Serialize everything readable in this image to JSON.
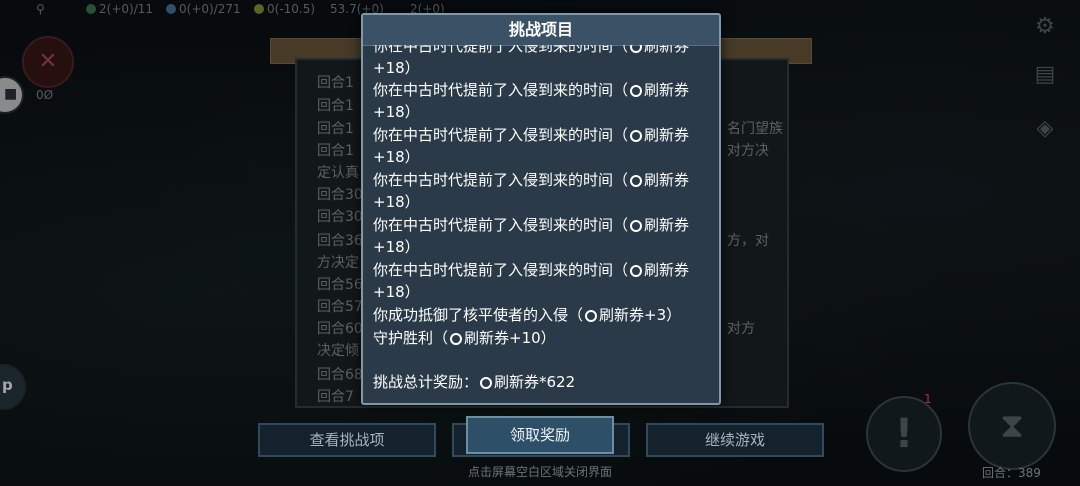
{
  "topbar": {
    "stat1": "2(+0)/11",
    "stat2": "0(+0)/271",
    "stat3": "0(-10.5)",
    "stat4": "53.7(+0)",
    "stat5": "2(+0)"
  },
  "left": {
    "count_label": "0Ø"
  },
  "log": {
    "lines": [
      "回合1",
      "回合1",
      "回合1",
      "回合1",
      "定认真",
      "回合30",
      "回合30",
      "回合36",
      "方决定",
      "回合56",
      "回合57",
      "回合60",
      "决定倾",
      "回合68",
      "回合7"
    ],
    "right_fragments": [
      "名门望族",
      "对方决",
      "方，对",
      "对方"
    ]
  },
  "dialog": {
    "title": "挑战项目",
    "items": [
      {
        "text": "你在中古时代提前了入侵到来的时间（",
        "reward": "刷新券",
        "suffix": "+18）"
      },
      {
        "text": "你在中古时代提前了入侵到来的时间（",
        "reward": "刷新券",
        "suffix": "+18）"
      },
      {
        "text": "你在中古时代提前了入侵到来的时间（",
        "reward": "刷新券",
        "suffix": "+18）"
      },
      {
        "text": "你在中古时代提前了入侵到来的时间（",
        "reward": "刷新券",
        "suffix": "+18）"
      },
      {
        "text": "你在中古时代提前了入侵到来的时间（",
        "reward": "刷新券",
        "suffix": "+18）"
      },
      {
        "text": "你在中古时代提前了入侵到来的时间（",
        "reward": "刷新券",
        "suffix": "+18）"
      }
    ],
    "defense": "你成功抵御了核平使者的入侵（",
    "defense_reward": "刷新券+3）",
    "victory": "守护胜利（",
    "victory_reward": "刷新券+10）",
    "total_label": "挑战总计奖励：",
    "total_reward": "刷新券*622"
  },
  "buttons": {
    "view_challenges": "查看挑战项",
    "claim_reward": "领取奖励",
    "continue_game": "继续游戏"
  },
  "hint": "点击屏幕空白区域关闭界面",
  "round_label": "回合：389",
  "notification_count": "1"
}
